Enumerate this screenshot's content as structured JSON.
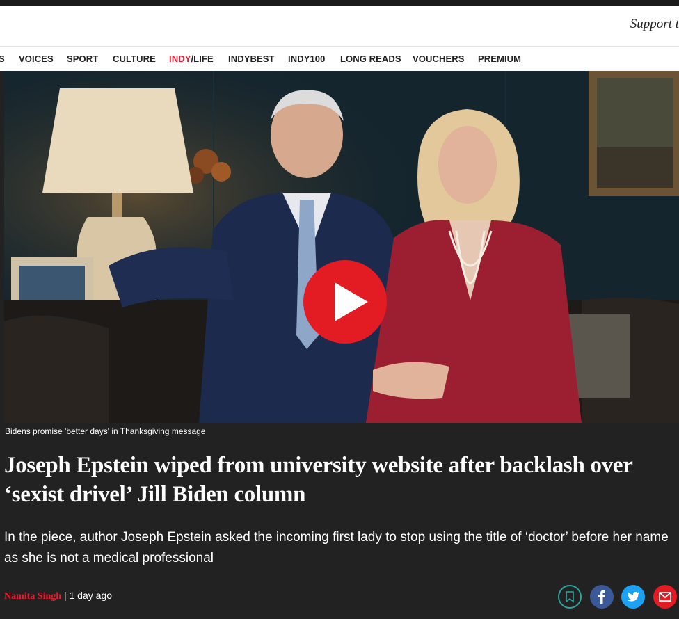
{
  "header": {
    "support_text": "Support t"
  },
  "nav": {
    "items": [
      {
        "label": "S"
      },
      {
        "label": "VOICES"
      },
      {
        "label": "SPORT"
      },
      {
        "label": "CULTURE"
      },
      {
        "label_red": "INDY",
        "label_rest": "/LIFE"
      },
      {
        "label": "INDYBEST"
      },
      {
        "label": "INDY100"
      },
      {
        "label": "LONG READS"
      },
      {
        "label": "VOUCHERS"
      },
      {
        "label": "PREMIUM"
      }
    ]
  },
  "video": {
    "caption": "Bidens promise 'better days' in Thanksgiving message",
    "play_icon": "play-icon"
  },
  "article": {
    "headline": "Joseph Epstein wiped from university website after backlash over ‘sexist drivel’ Jill Biden column",
    "standfirst": "In the piece, author Joseph Epstein asked the incoming first lady to stop using the title of ‘doctor’ before her name as she is not a medical professional",
    "author": "Namita Singh",
    "separator": " | ",
    "time": "1 day ago"
  },
  "share": {
    "icons": [
      "bookmark-icon",
      "facebook-icon",
      "twitter-icon",
      "email-icon"
    ]
  },
  "colors": {
    "accent": "#ec1a2e",
    "background": "#222222",
    "facebook": "#3b5998",
    "twitter": "#1da1f2",
    "email": "#e31b23",
    "bookmark_border": "#2ba6a0"
  }
}
